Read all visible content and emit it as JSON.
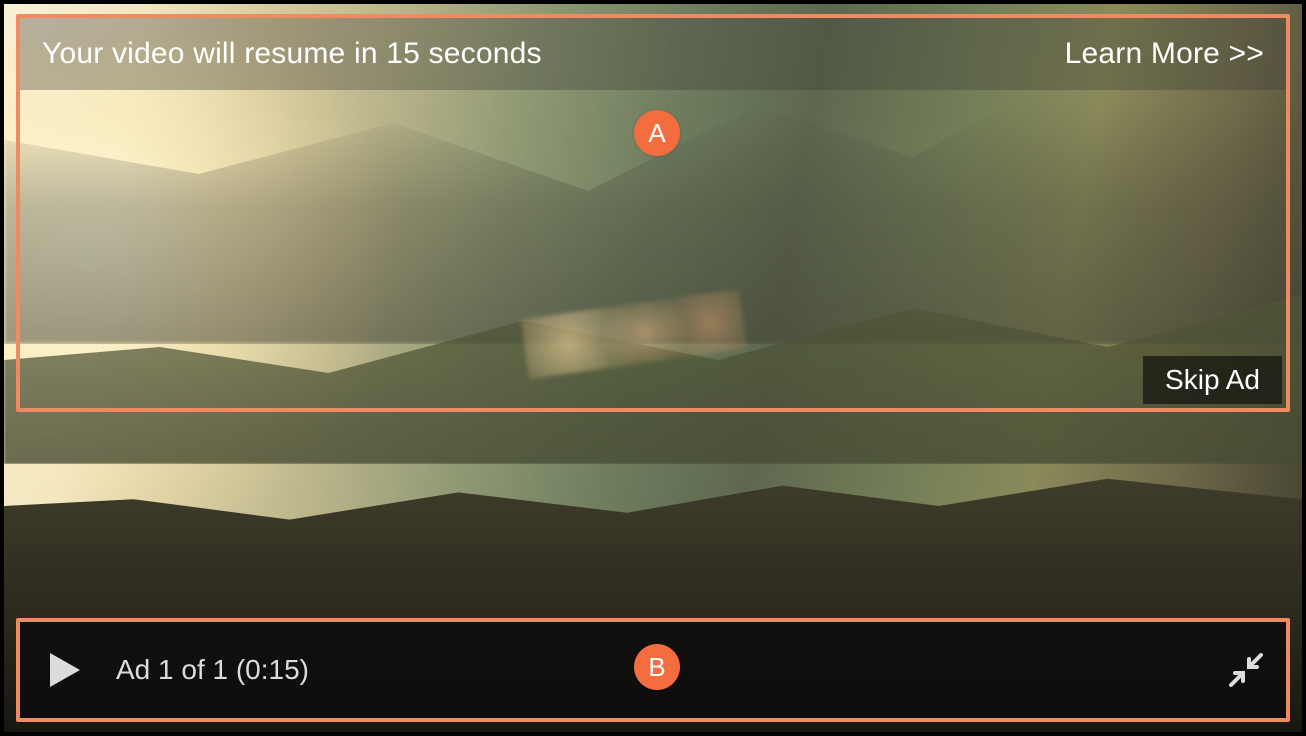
{
  "overlay": {
    "resume_text": "Your video will resume in 15 seconds",
    "learn_more_label": "Learn More >>",
    "skip_ad_label": "Skip Ad"
  },
  "controls": {
    "ad_status": "Ad 1 of 1  (0:15)"
  },
  "annotations": {
    "marker_a": "A",
    "marker_b": "B"
  },
  "colors": {
    "highlight_border": "#f08a62",
    "marker_bg": "#f46d3f"
  }
}
